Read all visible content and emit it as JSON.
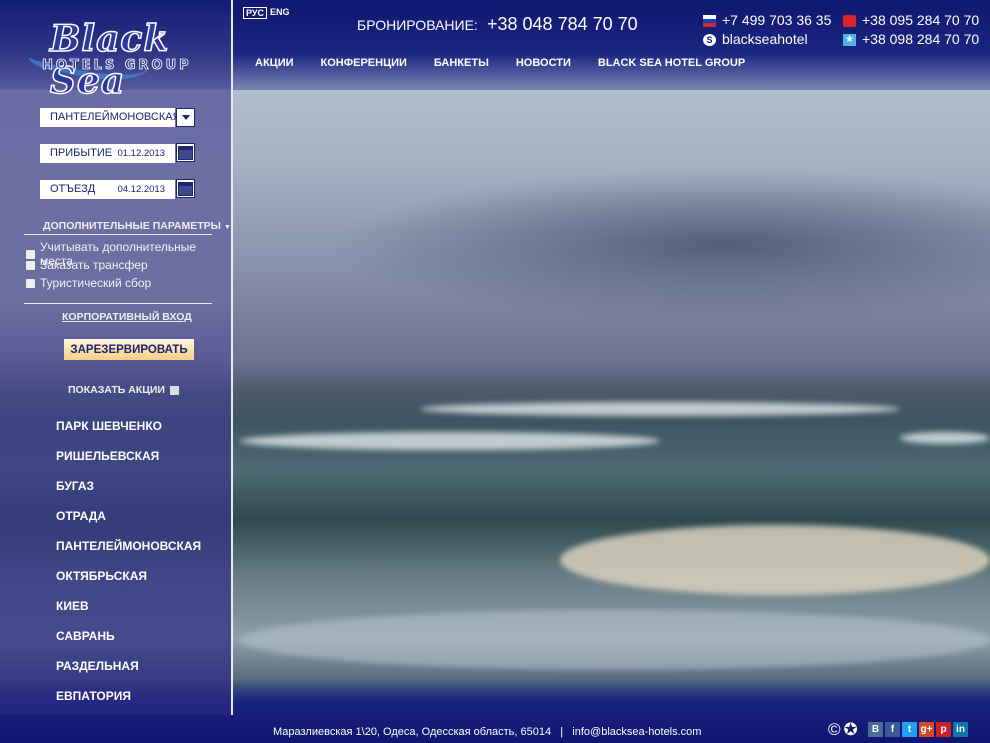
{
  "brand": {
    "name": "Black Sea",
    "sub": "HOTELS GROUP"
  },
  "language": {
    "active": "РУС",
    "other": "ENG"
  },
  "booking": {
    "label": "БРОНИРОВАНИЕ:",
    "phone": "+38 048 784 70 70"
  },
  "nav": [
    "АКЦИИ",
    "КОНФЕРЕНЦИИ",
    "БАНКЕТЫ",
    "НОВОСТИ",
    "BLACK SEA HOTEL GROUP"
  ],
  "contacts": {
    "ru_phone": "+7 499 703 36 35",
    "skype": "blackseahotel",
    "mts_phone": "+38 095 284 70 70",
    "kyivstar_phone": "+38 098 284 70 70"
  },
  "form": {
    "hotel_select": "ПАНТЕЛЕЙМОНОВСКАЯ",
    "arrival_label": "ПРИБЫТИЕ",
    "arrival_date": "01.12.2013",
    "departure_label": "ОТЪЕЗД",
    "departure_date": "04.12.2013",
    "options_title": "ДОПОЛНИТЕЛЬНЫЕ ПАРАМЕТРЫ",
    "options": [
      "Учитывать дополнительные места",
      "Заказать трансфер",
      "Туристический сбор"
    ],
    "corporate_login": "КОРПОРАТИВНЫЙ ВХОД",
    "reserve_button": "ЗАРЕЗЕРВИРОВАТЬ",
    "show_promos": "ПОКАЗАТЬ АКЦИИ"
  },
  "hotels": [
    "ПАРК ШЕВЧЕНКО",
    "РИШЕЛЬЕВСКАЯ",
    "БУГАЗ",
    "ОТРАДА",
    "ПАНТЕЛЕЙМОНОВСКАЯ",
    "ОКТЯБРЬСКАЯ",
    "КИЕВ",
    "САВРАНЬ",
    "РАЗДЕЛЬНАЯ",
    "ЕВПАТОРИЯ"
  ],
  "footer": {
    "address": "Маразлиевская 1\\20, Одеса, Одесская область, 65014",
    "separator": "|",
    "email": "info@blacksea-hotels.com"
  },
  "social": [
    {
      "icon": "vk-icon",
      "glyph": "B",
      "color": "#4a6a9a"
    },
    {
      "icon": "facebook-icon",
      "glyph": "f",
      "color": "#3b5998"
    },
    {
      "icon": "twitter-icon",
      "glyph": "t",
      "color": "#1da1f2"
    },
    {
      "icon": "google-plus-icon",
      "glyph": "g+",
      "color": "#d34a2a"
    },
    {
      "icon": "pinterest-icon",
      "glyph": "p",
      "color": "#cb2027"
    },
    {
      "icon": "linkedin-icon",
      "glyph": "in",
      "color": "#0e76a8"
    }
  ]
}
